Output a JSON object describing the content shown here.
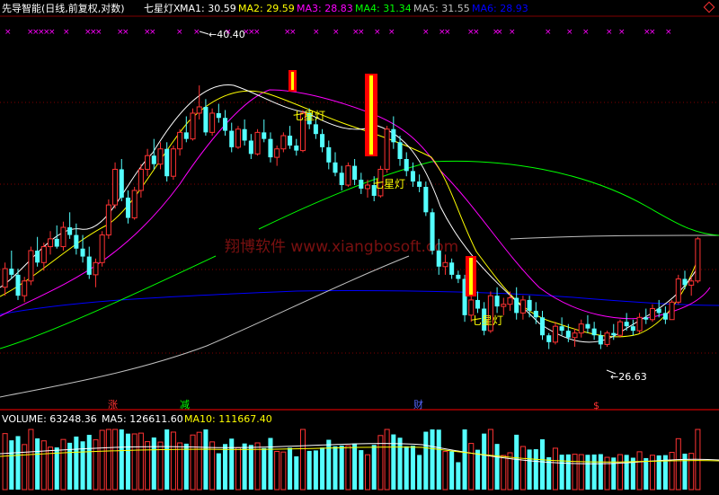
{
  "header": {
    "title": "先导智能(日线,前复权,对数)",
    "indicator_name": "七星灯X",
    "ma": [
      {
        "label": "MA1: 30.59",
        "color": "#ffffff"
      },
      {
        "label": "MA2: 29.59",
        "color": "#ffff00"
      },
      {
        "label": "MA3: 28.83",
        "color": "#ff00ff"
      },
      {
        "label": "MA4: 31.34",
        "color": "#00ff00"
      },
      {
        "label": "MA5: 31.55",
        "color": "#c0c0c0"
      },
      {
        "label": "MA6: 28.93",
        "color": "#0000ff"
      }
    ]
  },
  "annotations": {
    "high_price": "40.40",
    "low_price": "26.63",
    "star_lamp_label": "七星灯",
    "watermark": "翔博软件 www.xiangbosoft.com",
    "markers": [
      "涨",
      "减",
      "财",
      "$"
    ]
  },
  "volume_header": {
    "volume": "VOLUME: 63248.36",
    "ma5": "MA5: 126611.60",
    "ma10": "MA10: 111667.40"
  },
  "colors": {
    "up": "#ff3333",
    "down": "#54ffff",
    "ma1": "#ffffff",
    "ma2": "#ffff00",
    "ma3": "#ff00ff",
    "ma4": "#00ff00",
    "ma5": "#c0c0c0",
    "ma6": "#0000ff",
    "grid": "#800000",
    "lamp_red": "#ff0000",
    "lamp_yellow": "#ffff00"
  },
  "chart_data": {
    "type": "candlestick",
    "scale": "log",
    "ylim": [
      24,
      45
    ],
    "candles": [
      [
        29.0,
        30.2,
        28.6,
        29.9
      ],
      [
        29.9,
        30.8,
        29.4,
        29.6
      ],
      [
        29.6,
        29.9,
        28.4,
        28.6
      ],
      [
        28.6,
        29.5,
        28.3,
        29.3
      ],
      [
        29.3,
        31.0,
        29.1,
        30.8
      ],
      [
        30.8,
        31.5,
        30.0,
        30.2
      ],
      [
        30.2,
        31.2,
        29.8,
        31.0
      ],
      [
        31.0,
        31.8,
        30.6,
        31.4
      ],
      [
        31.4,
        32.1,
        30.9,
        31.0
      ],
      [
        31.0,
        32.3,
        30.8,
        32.0
      ],
      [
        32.0,
        32.8,
        31.4,
        31.6
      ],
      [
        31.6,
        32.2,
        30.6,
        30.9
      ],
      [
        30.9,
        31.6,
        30.2,
        30.5
      ],
      [
        30.5,
        31.0,
        29.4,
        29.6
      ],
      [
        29.6,
        30.4,
        29.0,
        30.2
      ],
      [
        30.2,
        31.8,
        30.0,
        31.6
      ],
      [
        31.6,
        33.5,
        31.4,
        33.2
      ],
      [
        33.2,
        35.6,
        33.0,
        35.2
      ],
      [
        35.2,
        35.8,
        33.4,
        33.6
      ],
      [
        33.6,
        34.0,
        32.2,
        32.5
      ],
      [
        32.5,
        34.2,
        32.4,
        34.0
      ],
      [
        34.0,
        35.5,
        33.6,
        35.2
      ],
      [
        35.2,
        36.4,
        34.8,
        36.0
      ],
      [
        36.0,
        37.0,
        35.2,
        35.5
      ],
      [
        35.5,
        36.8,
        35.2,
        36.4
      ],
      [
        36.4,
        36.8,
        34.5,
        34.8
      ],
      [
        34.8,
        36.6,
        34.6,
        36.4
      ],
      [
        36.4,
        37.6,
        36.0,
        37.4
      ],
      [
        37.4,
        38.4,
        36.8,
        37.0
      ],
      [
        37.0,
        38.9,
        36.9,
        38.6
      ],
      [
        38.6,
        40.4,
        38.2,
        39.0
      ],
      [
        39.0,
        39.5,
        37.2,
        37.4
      ],
      [
        37.4,
        38.9,
        37.2,
        38.6
      ],
      [
        38.6,
        39.2,
        38.0,
        38.3
      ],
      [
        38.3,
        38.8,
        37.2,
        37.5
      ],
      [
        37.5,
        38.0,
        36.2,
        36.5
      ],
      [
        36.5,
        37.8,
        36.4,
        37.6
      ],
      [
        37.6,
        38.2,
        36.6,
        36.9
      ],
      [
        36.9,
        37.3,
        35.8,
        36.1
      ],
      [
        36.1,
        37.6,
        36.0,
        37.4
      ],
      [
        37.4,
        38.2,
        36.8,
        37.0
      ],
      [
        37.0,
        37.4,
        35.6,
        35.9
      ],
      [
        35.9,
        36.6,
        35.4,
        36.4
      ],
      [
        36.4,
        37.4,
        36.2,
        37.2
      ],
      [
        37.2,
        37.8,
        36.4,
        36.6
      ],
      [
        36.6,
        37.0,
        36.0,
        36.3
      ],
      [
        36.3,
        38.8,
        36.2,
        38.6
      ],
      [
        38.6,
        38.9,
        37.6,
        37.9
      ],
      [
        37.9,
        38.3,
        37.0,
        37.3
      ],
      [
        37.3,
        37.6,
        36.2,
        36.5
      ],
      [
        36.5,
        36.9,
        35.2,
        35.6
      ],
      [
        35.6,
        36.2,
        34.8,
        35.0
      ],
      [
        35.0,
        35.4,
        34.0,
        34.3
      ],
      [
        34.3,
        35.6,
        34.2,
        35.4
      ],
      [
        35.4,
        35.8,
        34.3,
        34.6
      ],
      [
        34.6,
        35.0,
        33.8,
        34.1
      ],
      [
        34.1,
        34.6,
        33.6,
        34.3
      ],
      [
        34.3,
        34.8,
        33.4,
        33.7
      ],
      [
        33.7,
        35.4,
        33.6,
        35.2
      ],
      [
        35.2,
        37.8,
        35.0,
        37.6
      ],
      [
        37.6,
        38.4,
        36.4,
        36.8
      ],
      [
        36.8,
        37.2,
        35.4,
        35.8
      ],
      [
        35.8,
        36.2,
        34.8,
        35.1
      ],
      [
        35.1,
        35.6,
        34.2,
        34.5
      ],
      [
        34.5,
        34.9,
        33.9,
        34.2
      ],
      [
        34.2,
        34.5,
        32.6,
        32.8
      ],
      [
        32.8,
        33.0,
        30.6,
        30.8
      ],
      [
        30.8,
        31.4,
        29.6,
        30.0
      ],
      [
        30.0,
        30.6,
        29.6,
        30.2
      ],
      [
        30.2,
        30.4,
        29.4,
        29.6
      ],
      [
        29.6,
        29.8,
        29.2,
        29.4
      ],
      [
        29.4,
        29.6,
        27.4,
        27.7
      ],
      [
        27.7,
        28.6,
        27.4,
        28.4
      ],
      [
        28.4,
        28.8,
        27.8,
        28.0
      ],
      [
        28.0,
        28.3,
        26.8,
        27.0
      ],
      [
        27.0,
        28.8,
        26.9,
        28.6
      ],
      [
        28.6,
        29.0,
        27.8,
        28.1
      ],
      [
        28.1,
        28.5,
        27.7,
        28.2
      ],
      [
        28.2,
        28.8,
        27.9,
        28.5
      ],
      [
        28.5,
        29.0,
        27.5,
        27.8
      ],
      [
        27.8,
        28.6,
        27.5,
        28.4
      ],
      [
        28.4,
        28.6,
        27.6,
        27.9
      ],
      [
        27.9,
        28.3,
        27.3,
        27.6
      ],
      [
        27.6,
        27.9,
        26.6,
        26.8
      ],
      [
        26.8,
        26.9,
        26.2,
        26.5
      ],
      [
        26.5,
        27.4,
        26.4,
        27.2
      ],
      [
        27.2,
        27.6,
        26.8,
        27.0
      ],
      [
        27.0,
        27.3,
        26.5,
        26.7
      ],
      [
        26.7,
        27.1,
        26.3,
        26.9
      ],
      [
        26.9,
        27.5,
        26.7,
        27.3
      ],
      [
        27.3,
        27.7,
        26.9,
        27.1
      ],
      [
        27.1,
        27.4,
        26.6,
        26.8
      ],
      [
        26.8,
        27.0,
        26.2,
        26.4
      ],
      [
        26.4,
        27.0,
        26.3,
        26.9
      ],
      [
        26.9,
        27.3,
        26.6,
        26.8
      ],
      [
        26.8,
        27.5,
        26.7,
        27.4
      ],
      [
        27.4,
        27.8,
        27.0,
        27.2
      ],
      [
        27.2,
        27.5,
        26.8,
        27.0
      ],
      [
        27.0,
        27.8,
        26.9,
        27.6
      ],
      [
        27.6,
        28.0,
        27.3,
        27.5
      ],
      [
        27.5,
        28.2,
        27.4,
        28.0
      ],
      [
        28.0,
        28.4,
        27.6,
        27.8
      ],
      [
        27.8,
        28.1,
        27.3,
        27.5
      ],
      [
        27.5,
        28.4,
        27.5,
        28.3
      ],
      [
        28.3,
        29.6,
        28.2,
        29.4
      ],
      [
        29.4,
        29.8,
        28.9,
        29.1
      ],
      [
        29.1,
        29.5,
        28.6,
        29.3
      ],
      [
        29.3,
        31.5,
        29.2,
        31.4
      ]
    ]
  }
}
